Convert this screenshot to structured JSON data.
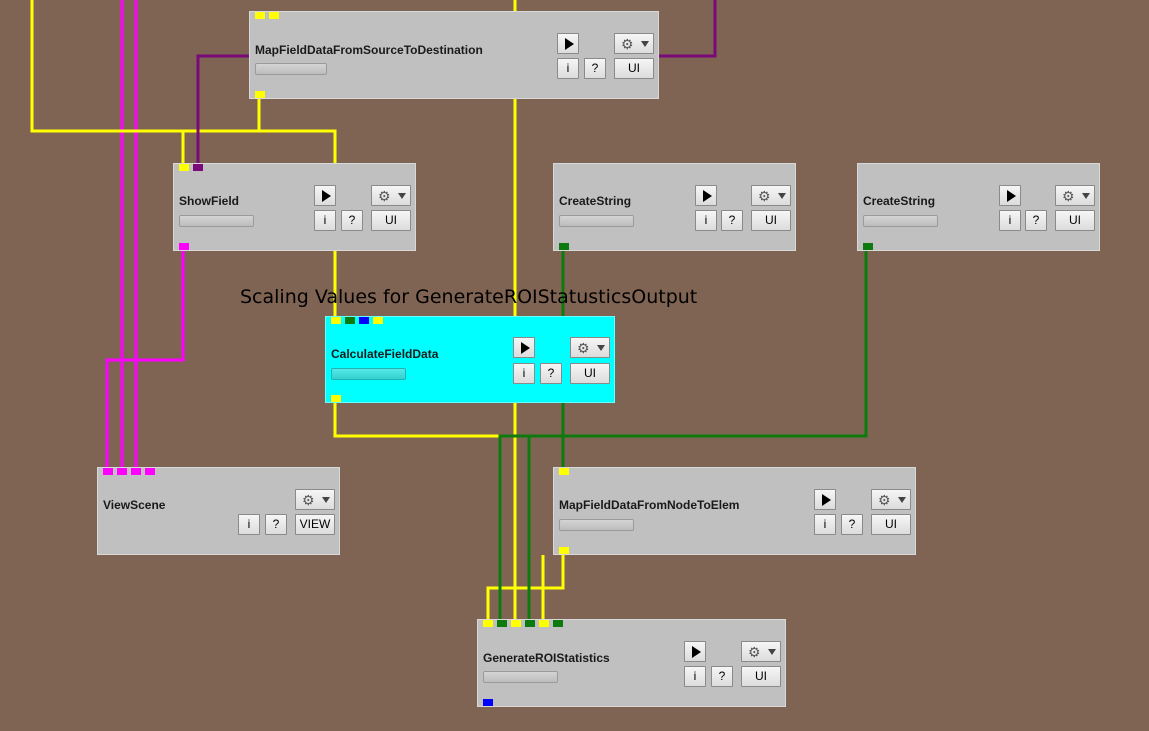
{
  "canvas": {
    "background": "#806453"
  },
  "note": {
    "text": "Scaling Values for GenerateROIStatusticsOutput"
  },
  "buttons": {
    "info": "i",
    "help": "?",
    "ui": "UI",
    "view": "VIEW",
    "execute_icon": "play-icon",
    "settings_icon": "gear-icon"
  },
  "modules": {
    "map_src_dst": {
      "title": "MapFieldDataFromSourceToDestination"
    },
    "show_field": {
      "title": "ShowField"
    },
    "create_string_1": {
      "title": "CreateString"
    },
    "create_string_2": {
      "title": "CreateString"
    },
    "calculate_field_data": {
      "title": "CalculateFieldData",
      "color": "#00ffff"
    },
    "view_scene": {
      "title": "ViewScene"
    },
    "map_node_elem": {
      "title": "MapFieldDataFromNodeToElem"
    },
    "generate_roi_stats": {
      "title": "GenerateROIStatistics"
    }
  },
  "wire_colors": {
    "field": "#ffff00",
    "geometry": "#ff00ff",
    "string": "#0c7a0c",
    "matrix": "#7a0a7a",
    "output": "#0000ff"
  }
}
